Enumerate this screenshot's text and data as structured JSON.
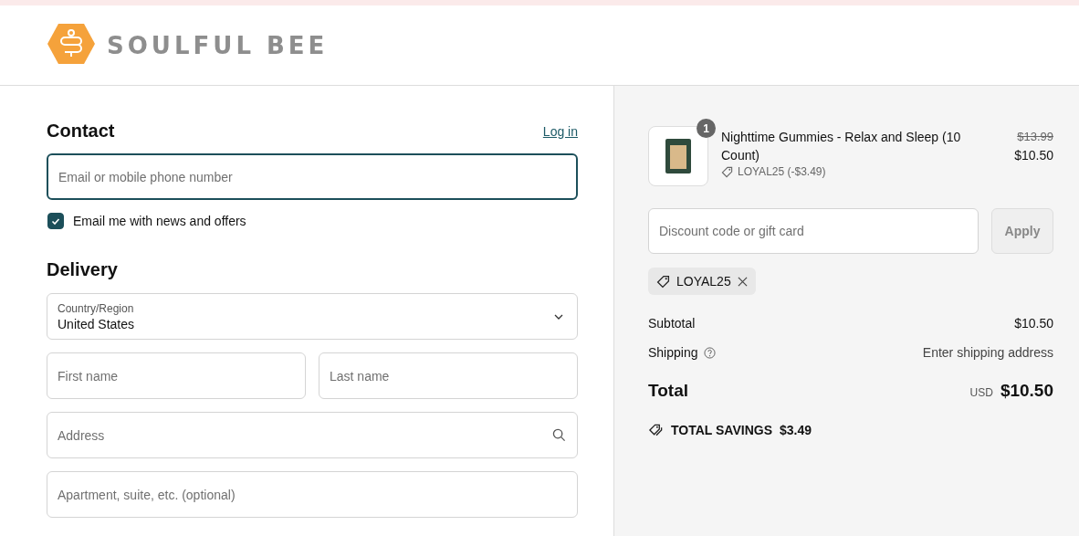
{
  "header": {
    "brand": "SOULFUL BEE"
  },
  "contact": {
    "heading": "Contact",
    "login_link": "Log in",
    "email": {
      "placeholder": "Email or mobile phone number",
      "focused": true
    },
    "newsletter": {
      "label": "Email me with news and offers",
      "checked": true
    }
  },
  "delivery": {
    "heading": "Delivery",
    "country": {
      "label": "Country/Region",
      "value": "United States"
    },
    "rows": [
      [
        {
          "placeholder": "First name",
          "kind": "text"
        },
        {
          "placeholder": "Last name",
          "kind": "text"
        }
      ],
      [
        {
          "placeholder": "Address",
          "kind": "search"
        }
      ],
      [
        {
          "placeholder": "Apartment, suite, etc. (optional)",
          "kind": "text"
        }
      ]
    ]
  },
  "summary": {
    "item": {
      "name": "Nighttime Gummies - Relax and Sleep (10 Count)",
      "quantity": "1",
      "discount": "LOYAL25 (-$3.49)",
      "original_price": "$13.99",
      "price": "$10.50"
    },
    "discount": {
      "placeholder": "Discount code or gift card",
      "button": "Apply"
    },
    "applied_codes": [
      {
        "code": "LOYAL25"
      }
    ],
    "lines": [
      {
        "label": "Subtotal",
        "value": "$10.50",
        "help": false
      },
      {
        "label": "Shipping",
        "value": "Enter shipping address",
        "help": true
      }
    ],
    "total": {
      "label": "Total",
      "currency": "USD",
      "amount": "$10.50"
    },
    "savings": {
      "label": "TOTAL SAVINGS",
      "amount": "$3.49"
    }
  }
}
